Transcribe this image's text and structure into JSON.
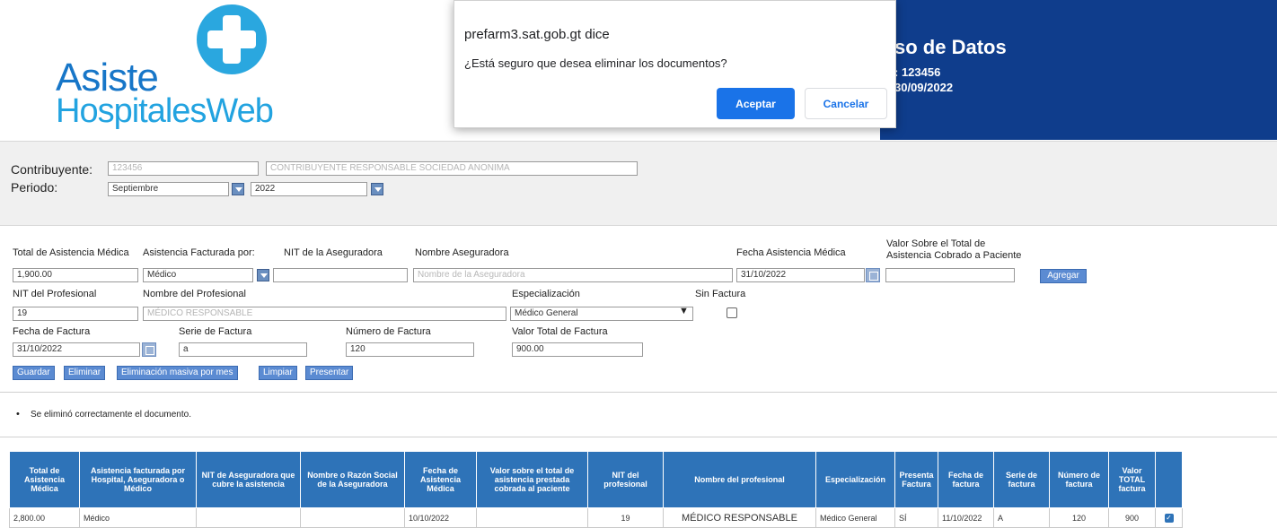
{
  "header": {
    "logo_line1": "Asiste",
    "logo_line2": "HospitalesWeb",
    "band_title": "so de Datos",
    "band_line1": ": 123456",
    "band_line2": "30/09/2022"
  },
  "dialog": {
    "title": "prefarm3.sat.gob.gt dice",
    "message": "¿Está seguro que desea eliminar los documentos?",
    "ok_label": "Aceptar",
    "cancel_label": "Cancelar"
  },
  "contribuyente": {
    "label": "Contribuyente:",
    "nit": "123456",
    "name": "CONTRIBUYENTE RESPONSABLE SOCIEDAD ANONIMA",
    "periodo_label": "Periodo:",
    "mes": "Septiembre",
    "anio": "2022"
  },
  "form": {
    "total_label": "Total de Asistencia Médica",
    "facturada_label": "Asistencia Facturada por:",
    "nit_aseg_label": "NIT de la Aseguradora",
    "nombre_aseg_label": "Nombre Aseguradora",
    "fecha_asist_label": "Fecha Asistencia Médica",
    "valor_sobre_label1": "Valor Sobre el Total de",
    "valor_sobre_label2": "Asistencia Cobrado a Paciente",
    "total_value": "1,900.00",
    "facturada_value": "Médico",
    "nit_aseg_value": "",
    "nombre_aseg_placeholder": "Nombre de la Aseguradora",
    "fecha_asist_value": "31/10/2022",
    "valor_sobre_value": "",
    "agregar_label": "Agregar",
    "nit_prof_label": "NIT del Profesional",
    "nombre_prof_label": "Nombre del Profesional",
    "especializacion_label": "Especialización",
    "sin_factura_label": "Sin Factura",
    "nit_prof_value": "19",
    "nombre_prof_value": "MÉDICO RESPONSABLE",
    "especializacion_value": "Médico General",
    "fecha_factura_label": "Fecha de Factura",
    "serie_label": "Serie de Factura",
    "numero_label": "Número de Factura",
    "valor_total_label": "Valor Total de Factura",
    "fecha_factura_value": "31/10/2022",
    "serie_value": "a",
    "numero_value": "120",
    "valor_total_value": "900.00"
  },
  "actions": {
    "guardar": "Guardar",
    "eliminar": "Eliminar",
    "eliminacion_masiva": "Eliminación masiva por mes",
    "limpiar": "Limpiar",
    "presentar": "Presentar"
  },
  "status_message": "Se eliminó correctamente el documento.",
  "table": {
    "headers": [
      "Total de Asistencia Médica",
      "Asistencia facturada por Hospital, Aseguradora o Médico",
      "NIT de Aseguradora que cubre la asistencia",
      "Nombre o Razón Social de la Aseguradora",
      "Fecha de Asistencia Médica",
      "Valor sobre el total de asistencia prestada cobrada al paciente",
      "NIT del profesional",
      "Nombre del profesional",
      "Especialización",
      "Presenta Factura",
      "Fecha de factura",
      "Serie de factura",
      "Número de factura",
      "Valor TOTAL factura",
      ""
    ],
    "rows": [
      [
        "2,800.00",
        "Médico",
        "",
        "",
        "10/10/2022",
        "",
        "19",
        "MÉDICO RESPONSABLE",
        "Médico General",
        "SÍ",
        "11/10/2022",
        "A",
        "120",
        "900",
        ""
      ]
    ]
  }
}
